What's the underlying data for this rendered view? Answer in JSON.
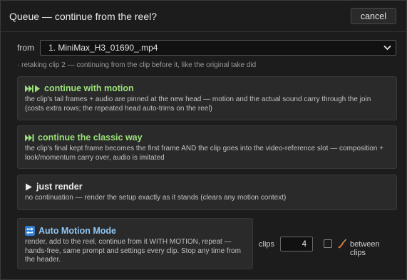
{
  "dialog": {
    "title": "Queue — continue from the reel?",
    "cancel_label": "cancel"
  },
  "from": {
    "label": "from",
    "selected": "1. MiniMax_H3_01690_.mp4"
  },
  "note": "· retaking clip 2 — continuing from the clip before it, like the original take did",
  "options": [
    {
      "icon": "skip-forward-play-icon",
      "title": "continue with motion",
      "desc": "the clip's tail frames + audio are pinned at the new head — motion and the actual sound carry through the join (costs extra rows; the repeated head auto-trims on the reel)"
    },
    {
      "icon": "skip-forward-icon",
      "title": "continue the classic way",
      "desc": "the clip's final kept frame becomes the first frame AND the clip goes into the video-reference slot — composition + look/momentum carry over, audio is imitated"
    },
    {
      "icon": "play-icon",
      "title": "just render",
      "desc": "no continuation — render the setup exactly as it stands (clears any motion context)"
    }
  ],
  "auto": {
    "icon": "repeat-icon",
    "title": "Auto Motion Mode",
    "desc": "render, add to the reel, continue from it WITH MOTION, repeat — hands-free, same prompt and settings every clip. Stop any time from the header.",
    "clips_label": "clips",
    "clips_value": "4",
    "between_label": "between clips",
    "between_checked": false,
    "between_icon": "broom-icon"
  },
  "colors": {
    "green": "#9be07a",
    "blue": "#8fc6f3",
    "accent_blue": "#2f7fd6"
  }
}
